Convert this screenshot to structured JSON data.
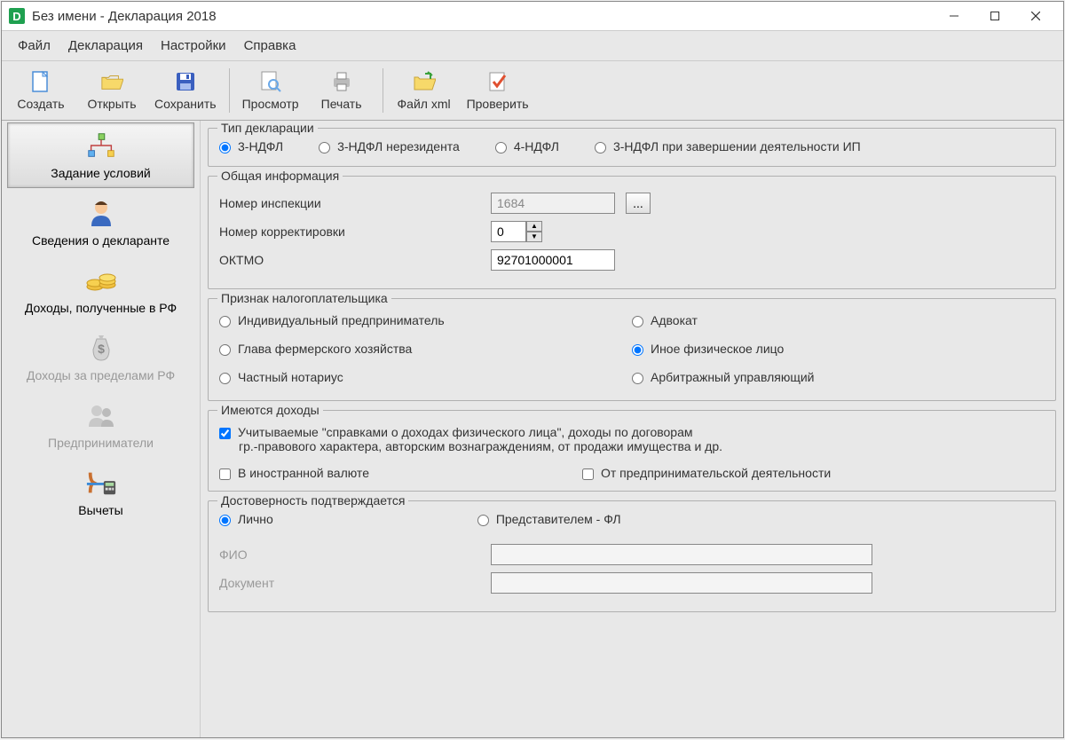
{
  "window": {
    "title": "Без имени - Декларация 2018"
  },
  "menu": {
    "file": "Файл",
    "decl": "Декларация",
    "settings": "Настройки",
    "help": "Справка"
  },
  "toolbar": {
    "create": "Создать",
    "open": "Открыть",
    "save": "Сохранить",
    "preview": "Просмотр",
    "print": "Печать",
    "xml": "Файл xml",
    "check": "Проверить"
  },
  "sidebar": {
    "conditions": "Задание условий",
    "declarant": "Сведения о декларанте",
    "income_rf": "Доходы, полученные в РФ",
    "income_abroad": "Доходы за пределами РФ",
    "entrepreneurs": "Предприниматели",
    "deductions": "Вычеты"
  },
  "decl_type": {
    "legend": "Тип декларации",
    "r1": "3-НДФЛ",
    "r2": "3-НДФЛ нерезидента",
    "r3": "4-НДФЛ",
    "r4": "3-НДФЛ при завершении деятельности ИП"
  },
  "general": {
    "legend": "Общая информация",
    "inspection_lbl": "Номер инспекции",
    "inspection_val": "1684",
    "correction_lbl": "Номер корректировки",
    "correction_val": "0",
    "oktmo_lbl": "ОКТМО",
    "oktmo_val": "92701000001",
    "ellipsis": "..."
  },
  "taxpayer": {
    "legend": "Признак налогоплательщика",
    "r1": "Индивидуальный предприниматель",
    "r2": "Адвокат",
    "r3": "Глава фермерского хозяйства",
    "r4": "Иное физическое лицо",
    "r5": "Частный нотариус",
    "r6": "Арбитражный управляющий"
  },
  "income": {
    "legend": "Имеются доходы",
    "c1_line1": "Учитываемые \"справками о доходах физического лица\", доходы по договорам",
    "c1_line2": "гр.-правового характера, авторским вознаграждениям, от продажи имущества и др.",
    "c2": "В иностранной валюте",
    "c3": "От предпринимательской деятельности"
  },
  "auth": {
    "legend": "Достоверность подтверждается",
    "r1": "Лично",
    "r2": "Представителем - ФЛ",
    "fio": "ФИО",
    "doc": "Документ"
  }
}
